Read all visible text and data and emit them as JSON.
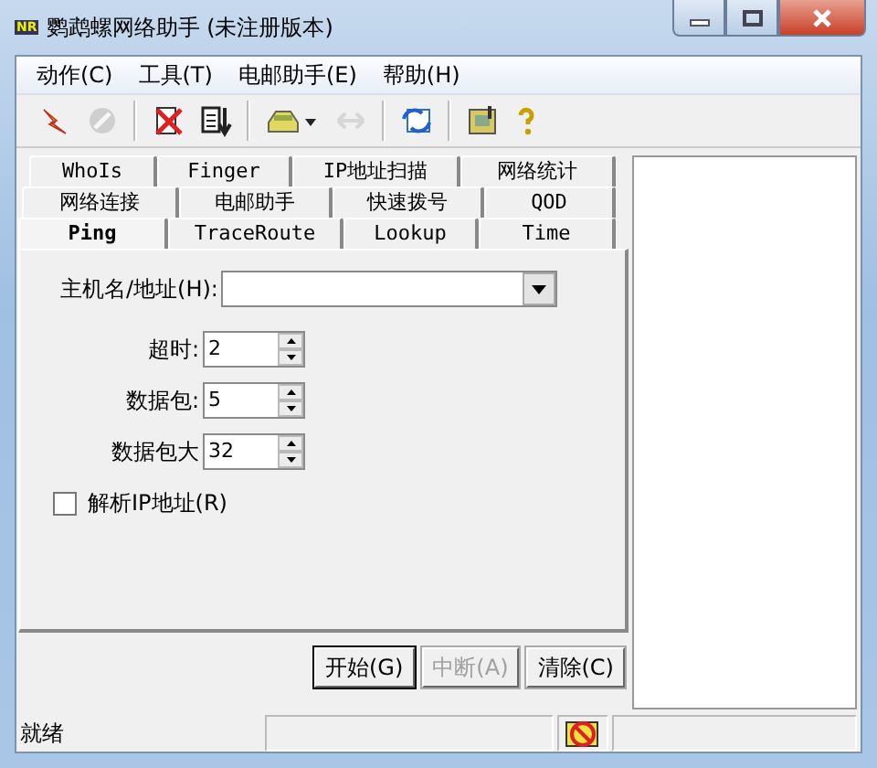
{
  "window": {
    "badge": "NR",
    "title": "鹦鹉螺网络助手 (未注册版本)"
  },
  "menu": [
    "动作(C)",
    "工具(T)",
    "电邮助手(E)",
    "帮助(H)"
  ],
  "toolbar": [
    {
      "disabled": false
    },
    {
      "disabled": true
    },
    {
      "disabled": false
    },
    {
      "disabled": false
    },
    {
      "disabled": false
    },
    {
      "disabled": true
    },
    {
      "disabled": false
    },
    {
      "disabled": false
    },
    {
      "disabled": false
    }
  ],
  "tab_rows": [
    [
      {
        "label": "WhoIs",
        "selected": false
      },
      {
        "label": "Finger",
        "selected": false
      },
      {
        "label": "IP地址扫描",
        "selected": false
      },
      {
        "label": "网络统计",
        "selected": false
      }
    ],
    [
      {
        "label": "网络连接",
        "selected": false
      },
      {
        "label": "电邮助手",
        "selected": false
      },
      {
        "label": "快速拨号",
        "selected": false
      },
      {
        "label": "QOD",
        "selected": false
      }
    ],
    [
      {
        "label": "Ping",
        "selected": true
      },
      {
        "label": "TraceRoute",
        "selected": false
      },
      {
        "label": "Lookup",
        "selected": false
      },
      {
        "label": "Time",
        "selected": false
      }
    ]
  ],
  "host": {
    "label": "主机名/地址(H):"
  },
  "spinners": [
    {
      "label": "超时:",
      "value": "2"
    },
    {
      "label": "数据包:",
      "value": "5"
    },
    {
      "label": "数据包大",
      "value": "32"
    }
  ],
  "resolve": {
    "label": "解析IP地址(R)",
    "checked": false
  },
  "buttons": [
    {
      "label": "开始(G)",
      "disabled": false
    },
    {
      "label": "中断(A)",
      "disabled": true
    },
    {
      "label": "清除(C)",
      "disabled": false
    }
  ],
  "status_bar": {
    "text": "就绪"
  }
}
